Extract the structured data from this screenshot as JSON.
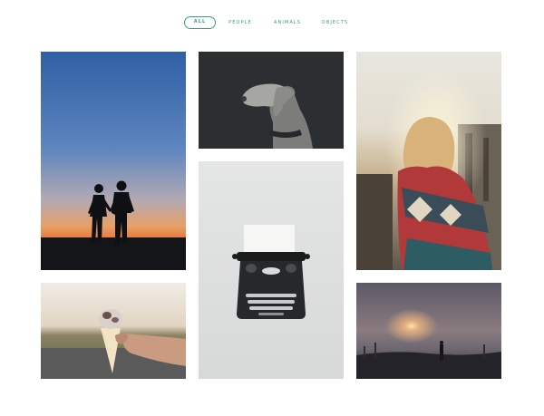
{
  "filters": {
    "all": "ALL",
    "people": "PEOPLE",
    "animals": "ANIMALS",
    "objects": "OBJECTS",
    "active": "all"
  },
  "colors": {
    "accent": "#3a9f7a",
    "background": "#ffffff"
  },
  "gallery": [
    {
      "photo": "couple-silhouette-sunset",
      "category": "people"
    },
    {
      "photo": "grey-dog-dark-background",
      "category": "animals"
    },
    {
      "photo": "woman-blanket-sunlight",
      "category": "people"
    },
    {
      "photo": "vintage-typewriter",
      "category": "objects"
    },
    {
      "photo": "hand-holding-ice-cream",
      "category": "objects"
    },
    {
      "photo": "foggy-field-sunrise",
      "category": "people"
    }
  ]
}
